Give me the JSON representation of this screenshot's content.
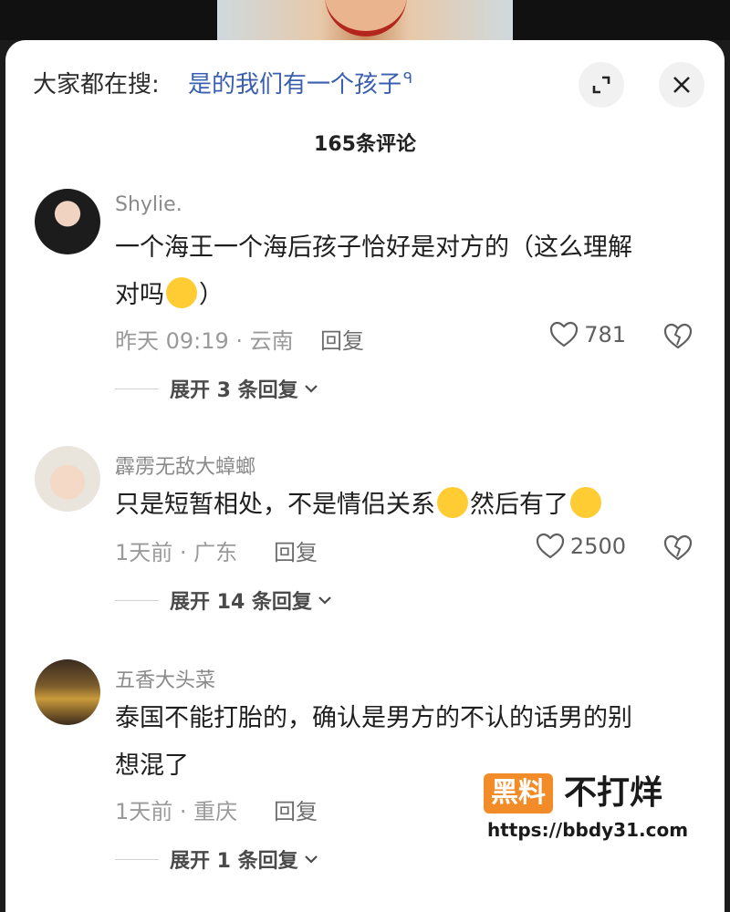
{
  "header": {
    "hot_search_prefix": "大家都在搜:",
    "hot_search_term": "是的我们有一个孩子",
    "search_icon_glyph": "ᑫ",
    "comments_count_title": "165条评论"
  },
  "comments": [
    {
      "username": "Shylie.",
      "text_line1": "一个海王一个海后孩子恰好是对方的（这么理解",
      "text_line2_pre": "对吗",
      "text_line2_post": "）",
      "emoji": "crying-laugh-emoji",
      "meta": "昨天 09:19 · 云南",
      "reply_label": "回复",
      "likes": "781",
      "expand_label": "展开 3 条回复"
    },
    {
      "username": "霹雳无敌大蟑螂",
      "text_pre": "只是短暂相处，不是情侣关系",
      "text_mid": "然后有了",
      "emoji1": "dizzy-face-emoji",
      "emoji2": "grinning-sweat-emoji",
      "meta": "1天前 · 广东",
      "reply_label": "回复",
      "likes": "2500",
      "expand_label": "展开 14 条回复"
    },
    {
      "username": "五香大头菜",
      "text_line1": "泰国不能打胎的，确认是男方的不认的话男的别",
      "text_line2": "想混了",
      "meta": "1天前 · 重庆",
      "reply_label": "回复",
      "expand_label": "展开 1 条回复"
    }
  ],
  "watermark": {
    "badge": "黑料",
    "text": "不打烊",
    "url": "https://bbdy31.com"
  },
  "colors": {
    "accent_link": "#3a5fb0",
    "watermark_orange": "#f28c28",
    "emoji_yellow": "#ffcc33"
  }
}
